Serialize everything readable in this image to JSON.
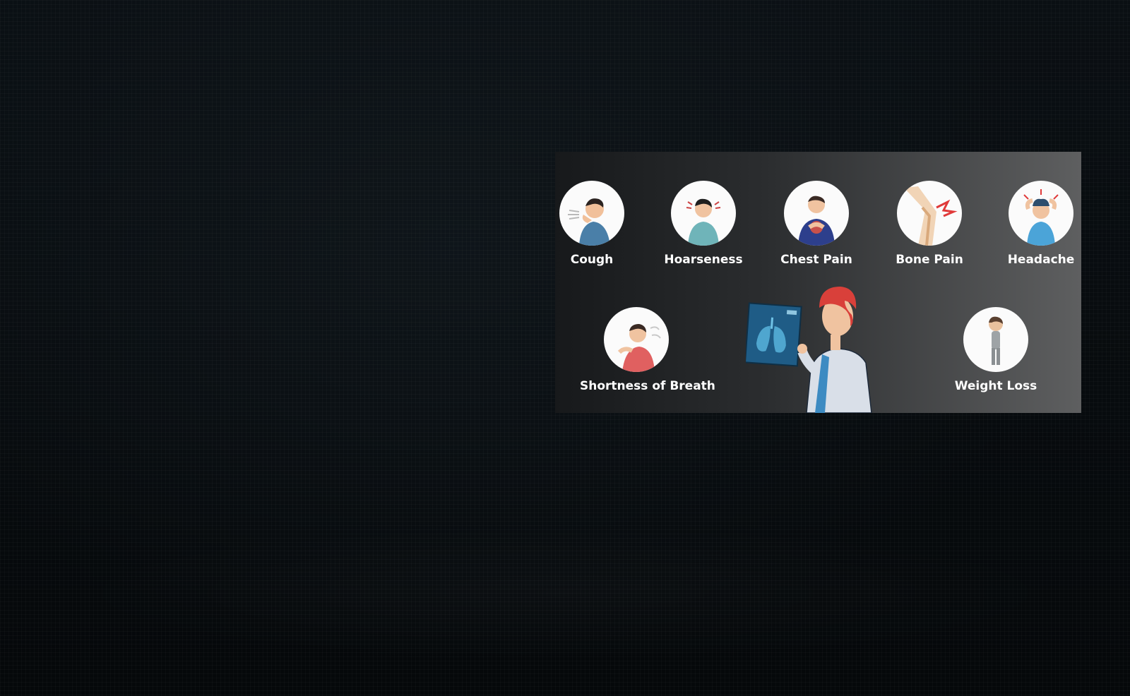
{
  "symptoms_top": [
    {
      "label": "Cough",
      "icon": "coughing-person-icon"
    },
    {
      "label": "Hoarseness",
      "icon": "hoarse-person-icon"
    },
    {
      "label": "Chest Pain",
      "icon": "chest-pain-person-icon"
    },
    {
      "label": "Bone Pain",
      "icon": "knee-bone-icon"
    },
    {
      "label": "Headache",
      "icon": "headache-person-icon"
    }
  ],
  "symptoms_bottom": [
    {
      "label": "Shortness of Breath",
      "icon": "breathless-person-icon"
    },
    {
      "label": "Weight Loss",
      "icon": "thin-person-icon"
    }
  ],
  "illustration": {
    "icon": "doctor-xray-lungs-icon"
  },
  "colors": {
    "panel_dark": "#17191b",
    "panel_light": "#5e5f60",
    "label_text": "#ffffff",
    "doctor_hair": "#d9403a",
    "xray_blue": "#1f5c86"
  }
}
